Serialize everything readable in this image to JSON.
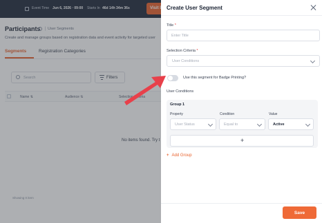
{
  "background": {
    "topbar": {
      "event_time_label": "Event Time",
      "event_time_value": "Jun 6, 2026 · 09:00",
      "starts_in_label": "Starts In",
      "starts_in_value": "46d 14h 34m 36s",
      "visit_button": "Visit E"
    },
    "page_title": "Participants",
    "breadcrumb": "User Segments",
    "description": "Create and manage groups based on registration data and event activity for targeted user",
    "tabs": [
      {
        "label": "Segments",
        "active": true
      },
      {
        "label": "Registration Categories",
        "active": false
      }
    ],
    "search_placeholder": "Search",
    "filters_label": "Filters",
    "columns": [
      "Name ⇅",
      "Audience ⇅",
      "Selection Criteria"
    ],
    "empty_message": "No items found. Try t",
    "showing": "Showing 0 item"
  },
  "drawer": {
    "title": "Create User Segment",
    "title_field": {
      "label": "Title",
      "required_mark": "*",
      "placeholder": "Enter Title",
      "value": ""
    },
    "criteria_field": {
      "label": "Selection Criteria",
      "required_mark": "*",
      "placeholder": "User Conditions"
    },
    "badge_toggle": {
      "label": "Use this segment for Badge Printing?",
      "on": false
    },
    "user_conditions_label": "User Conditions",
    "group": {
      "title": "Group 1",
      "columns": [
        "Property",
        "Condition",
        "Value"
      ],
      "row": {
        "property": "User Status",
        "condition": "Equal to",
        "value": "Active"
      },
      "add_row": "+"
    },
    "add_group": "Add Group",
    "save_button": "Save"
  },
  "colors": {
    "accent": "#e8612c",
    "annotation_arrow": "#e8404a",
    "overlay": "rgba(60,64,72,0.42)"
  },
  "icons": [
    "close-icon",
    "chevron-down-icon",
    "search-icon",
    "filter-icon",
    "info-icon",
    "plus-icon"
  ]
}
